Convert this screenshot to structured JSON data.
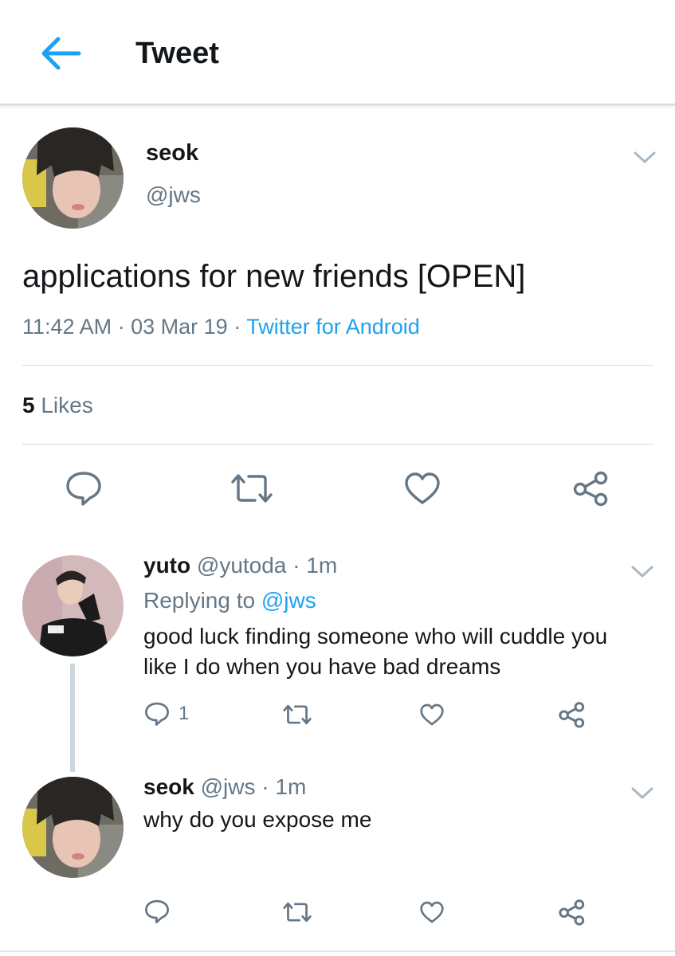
{
  "header": {
    "title": "Tweet",
    "back_icon": "back-arrow-icon"
  },
  "tweet": {
    "author_name": "seok",
    "author_handle": "@jws",
    "text": "applications for new friends [OPEN]",
    "time": "11:42 AM",
    "sep1": "·",
    "date": "03 Mar 19",
    "sep2": "·",
    "source": "Twitter for Android",
    "likes_count": "5",
    "likes_label": "Likes"
  },
  "replies": [
    {
      "name": "yuto",
      "handle": "@yutoda",
      "sep": "·",
      "time": "1m",
      "replying_prefix": "Replying to",
      "replying_to": "@jws",
      "text_line1": "good luck finding someone who will cuddle you",
      "text_line2": "like I do when you have bad dreams",
      "reply_count": "1"
    },
    {
      "name": "seok",
      "handle": "@jws",
      "sep": "·",
      "time": "1m",
      "text_line1": "why do you expose me"
    }
  ],
  "colors": {
    "accent": "#1da1f2",
    "icon": "#657786",
    "text": "#14171a",
    "secondary": "#657786"
  }
}
